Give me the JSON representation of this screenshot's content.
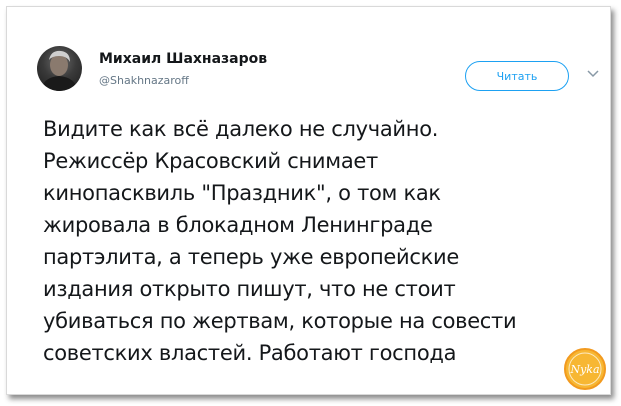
{
  "author": {
    "name": "Михаил Шахназаров",
    "handle": "@Shakhnazaroff",
    "avatar_icon": "user-photo-avatar"
  },
  "follow": {
    "label": "Читать",
    "chevron_icon": "chevron-down-icon"
  },
  "tweet": {
    "lines": [
      "Видите как всё далеко не случайно.",
      "Режиссёр Красовский снимает",
      "кинопасквиль \"Праздник\", о том как",
      "жировала в блокадном Ленинграде",
      "партэлита, а теперь уже европейские",
      "издания открыто пишут, что не стоит",
      "убиваться по жертвам, которые на совести",
      "советских властей. Работают господа"
    ]
  },
  "watermark": {
    "text": "Nyka",
    "color": "#f5a623"
  },
  "colors": {
    "accent": "#1da1f2",
    "text": "#14171a",
    "muted": "#657786"
  }
}
